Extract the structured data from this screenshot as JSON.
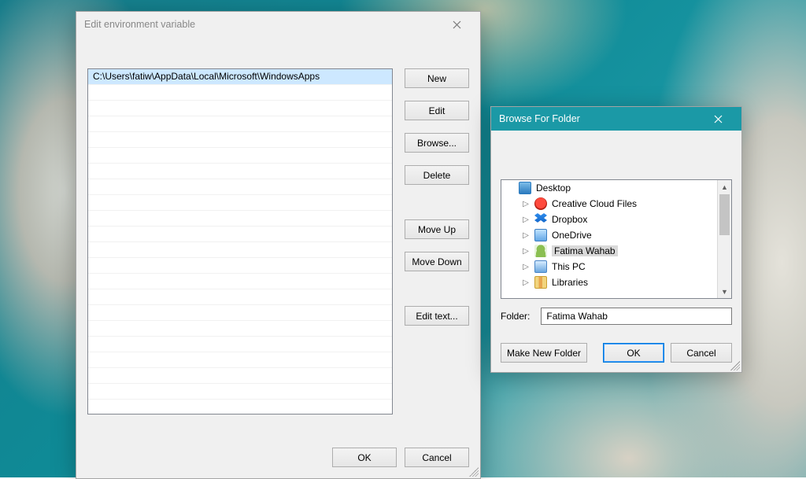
{
  "edit_env": {
    "title": "Edit environment variable",
    "entries": [
      "C:\\Users\\fatiw\\AppData\\Local\\Microsoft\\WindowsApps"
    ],
    "selected_index": 0,
    "buttons": {
      "new": "New",
      "edit": "Edit",
      "browse": "Browse...",
      "delete": "Delete",
      "move_up": "Move Up",
      "move_down": "Move Down",
      "edit_text": "Edit text..."
    },
    "ok": "OK",
    "cancel": "Cancel"
  },
  "browse": {
    "title": "Browse For Folder",
    "tree": {
      "root": "Desktop",
      "children": [
        {
          "icon": "cc",
          "label": "Creative Cloud Files"
        },
        {
          "icon": "dropbox",
          "label": "Dropbox"
        },
        {
          "icon": "folder-blue",
          "label": "OneDrive"
        },
        {
          "icon": "user",
          "label": "Fatima Wahab",
          "selected": true
        },
        {
          "icon": "pc",
          "label": "This PC"
        },
        {
          "icon": "lib",
          "label": "Libraries"
        }
      ]
    },
    "folder_label": "Folder:",
    "folder_value": "Fatima Wahab",
    "make_new": "Make New Folder",
    "ok": "OK",
    "cancel": "Cancel"
  }
}
